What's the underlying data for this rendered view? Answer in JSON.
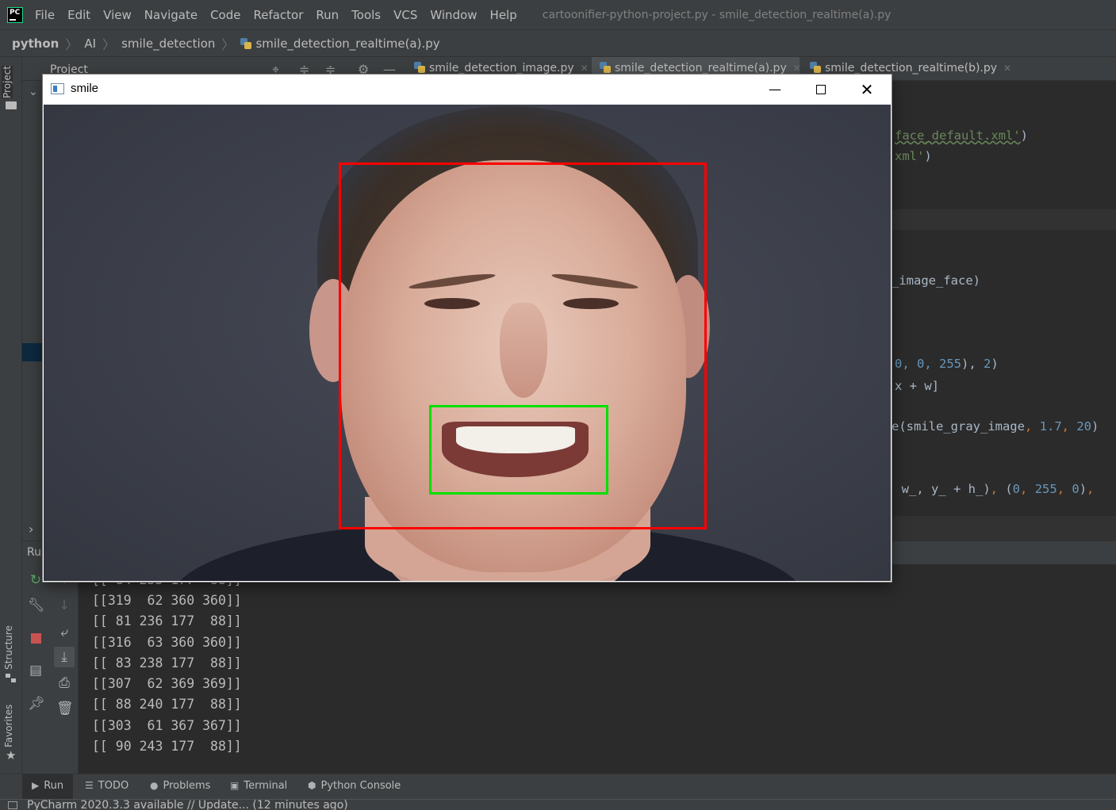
{
  "menubar": {
    "logo_text": "PC",
    "items": [
      "File",
      "Edit",
      "View",
      "Navigate",
      "Code",
      "Refactor",
      "Run",
      "Tools",
      "VCS",
      "Window",
      "Help"
    ],
    "window_title": "cartoonifier-python-project.py - smile_detection_realtime(a).py"
  },
  "breadcrumb": {
    "items": [
      "python",
      "AI",
      "smile_detection",
      "smile_detection_realtime(a).py"
    ]
  },
  "left_stripe": {
    "project": "Project",
    "structure": "Structure",
    "favorites": "Favorites"
  },
  "project_panel": {
    "title": "Project",
    "dropdown_icon": "chevron-down-icon"
  },
  "tabs": [
    {
      "label": "smile_detection_image.py",
      "active": false
    },
    {
      "label": "smile_detection_realtime(a).py",
      "active": true
    },
    {
      "label": "smile_detection_realtime(b).py",
      "active": false
    }
  ],
  "editor": {
    "lines": [
      {
        "pre": "",
        "str": "face_default.xml'",
        "post": ")"
      },
      {
        "pre": "",
        "str": "xml'",
        "post": ")"
      },
      {
        "text": "_image_face)"
      },
      {
        "text": "x + w]"
      }
    ],
    "line_rect": {
      "prefix": "0, 0, 255",
      "suffix": "2"
    },
    "line_smile": {
      "prefix": "e(smile_gray_image",
      "a": "1.7",
      "b": "20"
    },
    "line_rect2": {
      "text": "w_, y_ + h_)",
      "a": "0",
      "b": "255",
      "c": "0"
    }
  },
  "run_panel": {
    "label": "Run",
    "console_lines": [
      "[[ 84 233 177  88]]",
      "[[319  62 360 360]]",
      "[[ 81 236 177  88]]",
      "[[316  63 360 360]]",
      "[[ 83 238 177  88]]",
      "[[307  62 369 369]]",
      "[[ 88 240 177  88]]",
      "[[303  61 367 367]]",
      "[[ 90 243 177  88]]"
    ]
  },
  "bottom_tabs": {
    "run": "Run",
    "todo": "TODO",
    "problems": "Problems",
    "terminal": "Terminal",
    "python_console": "Python Console"
  },
  "status_bar": {
    "text": "PyCharm 2020.3.3 available // Update... (12 minutes ago)"
  },
  "cv_window": {
    "title": "smile",
    "face_box_color": "#ff0000",
    "smile_box_color": "#00e000"
  },
  "colors": {
    "ide_bg": "#2b2b2b",
    "panel_bg": "#3c3f41",
    "string": "#6a8759",
    "number": "#6897bb",
    "keyword": "#cc7832"
  }
}
